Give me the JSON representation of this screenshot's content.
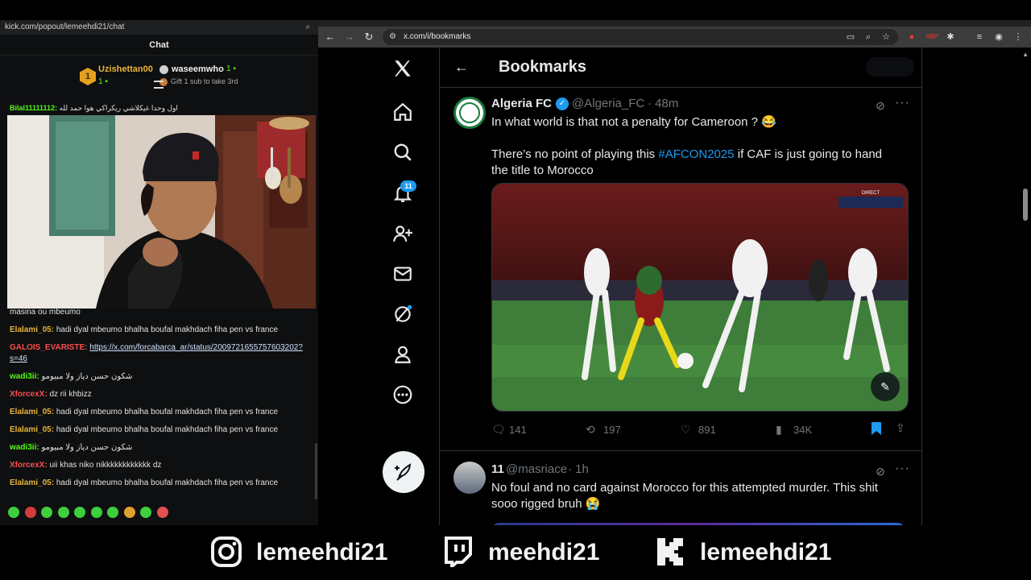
{
  "chat_window": {
    "url": "kick.com/popout/lemeehdi21/chat",
    "title": "Chat",
    "leaderboard": {
      "first_rank": "1",
      "first_name": "Uzishettan00",
      "first_count": "1",
      "second_name": "waseemwho",
      "second_count": "1",
      "third_text": "Gift 1 sub to take 3rd"
    },
    "pinned": {
      "user": "Bilal11111112:",
      "text": "اول وحدا غيكلاشي ريكراكي هوا حمد لله"
    },
    "messages": [
      {
        "user": "",
        "text": "masina ou mbeumo",
        "color": "#e2e2e2"
      },
      {
        "user": "Elalami_05:",
        "text": "hadi dyal mbeumo bhalha boufal makhdach fiha pen vs france",
        "color": "#e9b53a"
      },
      {
        "user": "GALOIS_EVARISTE:",
        "link": "https://x.com/forcabarca_ar/status/2009721655757603202?",
        "text": "",
        "color": "#ff4d4d"
      },
      {
        "user": "",
        "link": "s=46",
        "text": "",
        "color": "#ff4d4d"
      },
      {
        "user": "wadi3ii:",
        "text": "شكون حسن دياز ولا مبيومو",
        "color": "#53fc18"
      },
      {
        "user": "XforcexX:",
        "text": "dz rii khbizz",
        "color": "#ff4d4d"
      },
      {
        "user": "Elalami_05:",
        "text": "hadi dyal mbeumo bhalha boufal makhdach fiha pen vs france",
        "color": "#e9b53a"
      },
      {
        "user": "Elalami_05:",
        "text": "hadi dyal mbeumo bhalha boufal makhdach fiha pen vs france",
        "color": "#e9b53a"
      },
      {
        "user": "wadi3ii:",
        "text": "شكون حسن دياز ولا مبيومو",
        "color": "#53fc18"
      },
      {
        "user": "XforcexX:",
        "text": "uii khas niko nikkkkkkkkkkkk dz",
        "color": "#ff4d4d"
      },
      {
        "user": "Elalami_05:",
        "text": "hadi dyal mbeumo bhalha boufal makhdach fiha pen vs france",
        "color": "#e9b53a"
      }
    ],
    "emote_colors": [
      "#3ecf3e",
      "#d43b3b",
      "#3ecf3e",
      "#3ecf3e",
      "#3ecf3e",
      "#3ecf3e",
      "#3ecf3e",
      "#e0a030",
      "#3ecf3e",
      "#e05050"
    ]
  },
  "browser": {
    "url": "x.com/i/bookmarks"
  },
  "x": {
    "notifications_badge": "11",
    "page_title": "Bookmarks",
    "tweet1": {
      "name": "Algeria FC",
      "handle": "@Algeria_FC",
      "time": "· 48m",
      "line1": "In what world is that not a penalty for Cameroon ? 😂",
      "line2_pre": "There’s no point of playing this ",
      "hashtag": "#AFCON2025",
      "line2_post": " if CAF is just going to hand",
      "line3": "the title to Morocco",
      "replies": "141",
      "reposts": "197",
      "likes": "891",
      "views": "34K",
      "media_overlay": "DIRECT"
    },
    "tweet2": {
      "name": "11",
      "handle": "@masriace",
      "time": "· 1h",
      "line1": "No foul and no card against Morocco for this attempted murder. This shit",
      "line2": "sooo rigged bruh 😭"
    }
  },
  "socials": {
    "instagram": "lemeehdi21",
    "twitch": "meehdi21",
    "kick": "lemeehdi21"
  }
}
